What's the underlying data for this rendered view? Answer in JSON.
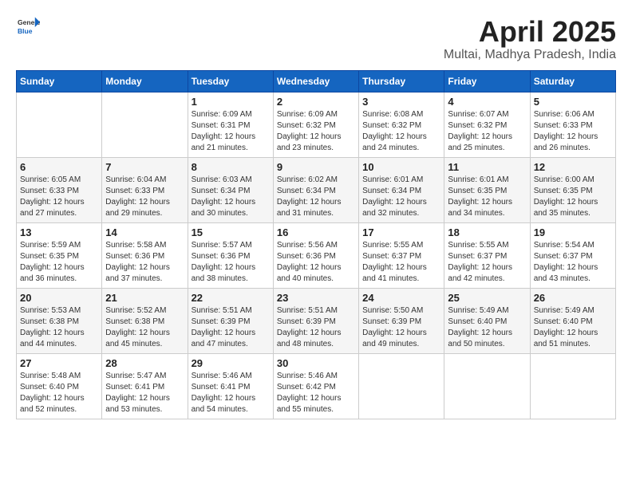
{
  "header": {
    "logo_general": "General",
    "logo_blue": "Blue",
    "title": "April 2025",
    "subtitle": "Multai, Madhya Pradesh, India"
  },
  "weekdays": [
    "Sunday",
    "Monday",
    "Tuesday",
    "Wednesday",
    "Thursday",
    "Friday",
    "Saturday"
  ],
  "weeks": [
    [
      {
        "day": "",
        "info": ""
      },
      {
        "day": "",
        "info": ""
      },
      {
        "day": "1",
        "info": "Sunrise: 6:09 AM\nSunset: 6:31 PM\nDaylight: 12 hours and 21 minutes."
      },
      {
        "day": "2",
        "info": "Sunrise: 6:09 AM\nSunset: 6:32 PM\nDaylight: 12 hours and 23 minutes."
      },
      {
        "day": "3",
        "info": "Sunrise: 6:08 AM\nSunset: 6:32 PM\nDaylight: 12 hours and 24 minutes."
      },
      {
        "day": "4",
        "info": "Sunrise: 6:07 AM\nSunset: 6:32 PM\nDaylight: 12 hours and 25 minutes."
      },
      {
        "day": "5",
        "info": "Sunrise: 6:06 AM\nSunset: 6:33 PM\nDaylight: 12 hours and 26 minutes."
      }
    ],
    [
      {
        "day": "6",
        "info": "Sunrise: 6:05 AM\nSunset: 6:33 PM\nDaylight: 12 hours and 27 minutes."
      },
      {
        "day": "7",
        "info": "Sunrise: 6:04 AM\nSunset: 6:33 PM\nDaylight: 12 hours and 29 minutes."
      },
      {
        "day": "8",
        "info": "Sunrise: 6:03 AM\nSunset: 6:34 PM\nDaylight: 12 hours and 30 minutes."
      },
      {
        "day": "9",
        "info": "Sunrise: 6:02 AM\nSunset: 6:34 PM\nDaylight: 12 hours and 31 minutes."
      },
      {
        "day": "10",
        "info": "Sunrise: 6:01 AM\nSunset: 6:34 PM\nDaylight: 12 hours and 32 minutes."
      },
      {
        "day": "11",
        "info": "Sunrise: 6:01 AM\nSunset: 6:35 PM\nDaylight: 12 hours and 34 minutes."
      },
      {
        "day": "12",
        "info": "Sunrise: 6:00 AM\nSunset: 6:35 PM\nDaylight: 12 hours and 35 minutes."
      }
    ],
    [
      {
        "day": "13",
        "info": "Sunrise: 5:59 AM\nSunset: 6:35 PM\nDaylight: 12 hours and 36 minutes."
      },
      {
        "day": "14",
        "info": "Sunrise: 5:58 AM\nSunset: 6:36 PM\nDaylight: 12 hours and 37 minutes."
      },
      {
        "day": "15",
        "info": "Sunrise: 5:57 AM\nSunset: 6:36 PM\nDaylight: 12 hours and 38 minutes."
      },
      {
        "day": "16",
        "info": "Sunrise: 5:56 AM\nSunset: 6:36 PM\nDaylight: 12 hours and 40 minutes."
      },
      {
        "day": "17",
        "info": "Sunrise: 5:55 AM\nSunset: 6:37 PM\nDaylight: 12 hours and 41 minutes."
      },
      {
        "day": "18",
        "info": "Sunrise: 5:55 AM\nSunset: 6:37 PM\nDaylight: 12 hours and 42 minutes."
      },
      {
        "day": "19",
        "info": "Sunrise: 5:54 AM\nSunset: 6:37 PM\nDaylight: 12 hours and 43 minutes."
      }
    ],
    [
      {
        "day": "20",
        "info": "Sunrise: 5:53 AM\nSunset: 6:38 PM\nDaylight: 12 hours and 44 minutes."
      },
      {
        "day": "21",
        "info": "Sunrise: 5:52 AM\nSunset: 6:38 PM\nDaylight: 12 hours and 45 minutes."
      },
      {
        "day": "22",
        "info": "Sunrise: 5:51 AM\nSunset: 6:39 PM\nDaylight: 12 hours and 47 minutes."
      },
      {
        "day": "23",
        "info": "Sunrise: 5:51 AM\nSunset: 6:39 PM\nDaylight: 12 hours and 48 minutes."
      },
      {
        "day": "24",
        "info": "Sunrise: 5:50 AM\nSunset: 6:39 PM\nDaylight: 12 hours and 49 minutes."
      },
      {
        "day": "25",
        "info": "Sunrise: 5:49 AM\nSunset: 6:40 PM\nDaylight: 12 hours and 50 minutes."
      },
      {
        "day": "26",
        "info": "Sunrise: 5:49 AM\nSunset: 6:40 PM\nDaylight: 12 hours and 51 minutes."
      }
    ],
    [
      {
        "day": "27",
        "info": "Sunrise: 5:48 AM\nSunset: 6:40 PM\nDaylight: 12 hours and 52 minutes."
      },
      {
        "day": "28",
        "info": "Sunrise: 5:47 AM\nSunset: 6:41 PM\nDaylight: 12 hours and 53 minutes."
      },
      {
        "day": "29",
        "info": "Sunrise: 5:46 AM\nSunset: 6:41 PM\nDaylight: 12 hours and 54 minutes."
      },
      {
        "day": "30",
        "info": "Sunrise: 5:46 AM\nSunset: 6:42 PM\nDaylight: 12 hours and 55 minutes."
      },
      {
        "day": "",
        "info": ""
      },
      {
        "day": "",
        "info": ""
      },
      {
        "day": "",
        "info": ""
      }
    ]
  ]
}
